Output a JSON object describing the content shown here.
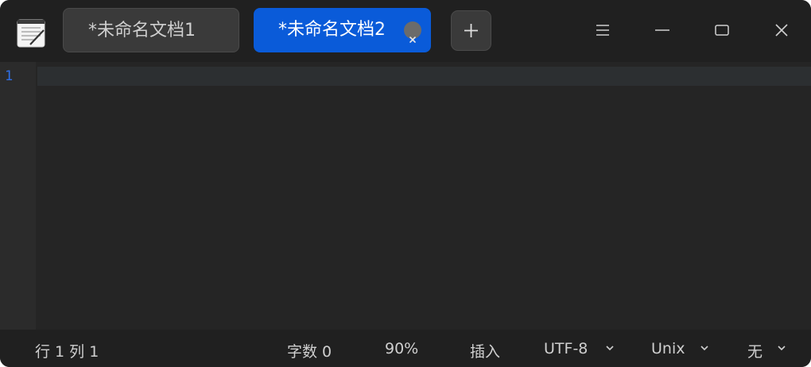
{
  "app": {
    "icon": "text-editor-icon"
  },
  "tabs": [
    {
      "label": "*未命名文档1",
      "active": false
    },
    {
      "label": "*未命名文档2",
      "active": true,
      "close_icon": "close-icon"
    }
  ],
  "toolbar": {
    "add_tab_icon": "plus-icon",
    "menu_icon": "hamburger-menu-icon",
    "minimize_icon": "minimize-icon",
    "maximize_icon": "maximize-icon",
    "close_icon": "close-icon"
  },
  "editor": {
    "line_numbers": [
      "1"
    ],
    "content": ""
  },
  "statusbar": {
    "position": "行 1  列 1",
    "char_count": "字数 0",
    "zoom": "90%",
    "mode": "插入",
    "encoding": "UTF-8",
    "line_ending": "Unix",
    "highlight": "无"
  },
  "colors": {
    "accent": "#0a5bd9",
    "background": "#202020",
    "editor_bg": "#252525",
    "line_number": "#2f6fe8"
  }
}
